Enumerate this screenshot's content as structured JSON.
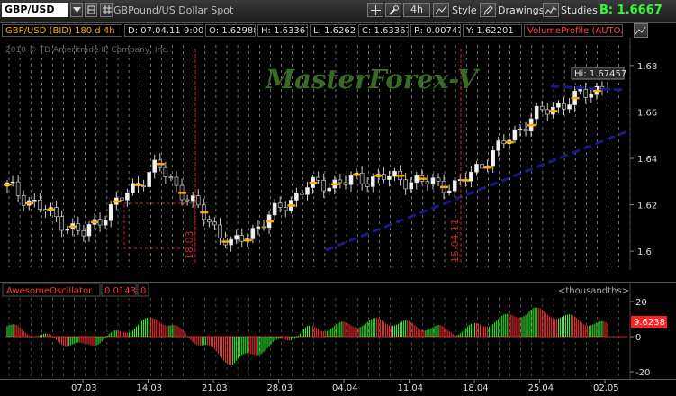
{
  "toolbar": {
    "symbol": "GBP/USD",
    "description": "GBPound/US Dollar Spot",
    "timeframe": "4h",
    "style_label": "Style",
    "drawings_label": "Drawings",
    "studies_label": "Studies",
    "bid_price": "B: 1.6667"
  },
  "infobar": {
    "symbol_info": "GBP/USD (BID) 180 d 4h",
    "date": "D: 07.04.11 9:00",
    "open": "O: 1.62988",
    "high": "H: 1.63367",
    "low": "L: 1.6262",
    "close": "C: 1.63367",
    "change": "R: 0.00747",
    "y": "Y: 1.62201",
    "volume_profile": "VolumeProfile (AUTO..."
  },
  "price_chart": {
    "copyright": "2010 © TD Ameritrade IP Company, Inc.",
    "watermark": "MasterForex-V",
    "high_tag": "Hi: 1.67457",
    "y_ticks": [
      "1.68",
      "1.66",
      "1.64",
      "1.62",
      "1.6"
    ],
    "marker_labels": [
      "18.03",
      "15.04.11"
    ]
  },
  "oscillator": {
    "name": "AwesomeOscillator",
    "value": "0.0143",
    "zero_field": "0",
    "units": "<thousandths>",
    "y_ticks": [
      "20",
      "0",
      "-20"
    ],
    "current_tag": "9.6238"
  },
  "x_axis": {
    "labels": [
      "07.03",
      "14.03",
      "21.03",
      "28.03",
      "04.04",
      "11.04",
      "18.04",
      "25.04",
      "02.05"
    ]
  },
  "chart_data": {
    "type": "line",
    "title": "GBP/USD (BID) 180 d 4h",
    "x": [
      "07.03",
      "14.03",
      "21.03",
      "28.03",
      "04.04",
      "11.04",
      "18.04",
      "25.04",
      "02.05"
    ],
    "ylim": [
      1.595,
      1.685
    ],
    "series": [
      {
        "name": "GBP/USD",
        "values": [
          1.628,
          1.607,
          1.637,
          1.602,
          1.628,
          1.632,
          1.628,
          1.658,
          1.672
        ]
      }
    ],
    "oscillator": {
      "name": "AwesomeOscillator",
      "ylim": [
        -20,
        20
      ],
      "values": [
        6,
        -6,
        11,
        -15,
        4,
        9,
        3,
        15,
        6
      ]
    },
    "legend": "none",
    "grid": true
  },
  "colors": {
    "bull": "#33ff33",
    "bear": "#ff3333",
    "trend": "#1a1a8c",
    "watermark": "#3a6b25",
    "marker": "#cc2222"
  }
}
